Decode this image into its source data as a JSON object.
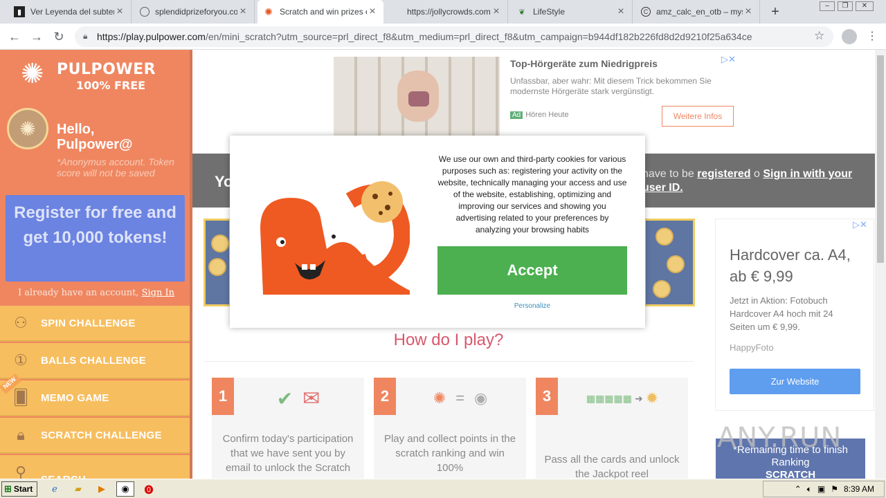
{
  "browser": {
    "tabs": [
      {
        "title": "Ver Leyenda del subterrá",
        "favicon": "film-icon"
      },
      {
        "title": "splendidprizeforyou.com",
        "favicon": "globe-icon"
      },
      {
        "title": "Scratch and win prizes e",
        "favicon": "octopus-icon",
        "active": true
      },
      {
        "title": "https://jollycrowds.com/",
        "favicon": "blank-icon"
      },
      {
        "title": "LifeStyle",
        "favicon": "leaf-icon"
      },
      {
        "title": "amz_calc_en_otb – mysi",
        "favicon": "c-icon"
      }
    ],
    "url_host": "https://play.pulpower.com",
    "url_path": "/en/mini_scratch?utm_source=prl_direct_f8&utm_medium=prl_direct_f8&utm_campaign=b944df182b226fd8d2d9210f25a634ce"
  },
  "sidebar": {
    "brand": "PULPOWER",
    "brand_sub": "100% FREE",
    "greeting": "Hello,",
    "username": "Pulpower@",
    "anon_note": "*Anonymus account. Token score will not be saved",
    "register_cta": "Register for free and get 10,000 tokens!",
    "already_text": "I already have an account,",
    "sign_in": "Sign In",
    "new_badge": "NEW",
    "menu": [
      {
        "label": "SPIN CHALLENGE",
        "icon": "bicycle-icon"
      },
      {
        "label": "BALLS CHALLENGE",
        "icon": "ball-icon"
      },
      {
        "label": "MEMO GAME",
        "icon": "cards-icon"
      },
      {
        "label": "SCRATCH CHALLENGE",
        "icon": "lock-icon"
      },
      {
        "label": "SEARCH",
        "icon": "search-icon"
      }
    ]
  },
  "top_ad": {
    "title": "Top-Hörgeräte zum Niedrigpreis",
    "text": "Unfassbar, aber wahr: Mit diesem Trick bekommen Sie modernste Hörgeräte stark vergünstigt.",
    "ad_label": "Ad",
    "advertiser": "Hören Heute",
    "button": "Weitere Infos"
  },
  "notice": {
    "prefix": "Yo",
    "text": "have to be",
    "registered": "registered",
    "or": "o",
    "sign_in_user": "Sign in with your user ID."
  },
  "howto": {
    "title": "How do I play?",
    "steps": [
      {
        "num": "1",
        "text": "Confirm today's participation that we have sent you by email to unlock the Scratch"
      },
      {
        "num": "2",
        "text": "Play and collect points in the scratch ranking and win 100%"
      },
      {
        "num": "3",
        "text": "Pass all the cards and unlock the Jackpot reel"
      }
    ]
  },
  "right_ad": {
    "headline": "Hardcover ca. A4, ab € 9,99",
    "text": "Jetzt in Aktion: Fotobuch Hardcover A4 hoch mit 24 Seiten um € 9,99.",
    "brand": "HappyFoto",
    "button": "Zur Website"
  },
  "right_banner": {
    "line1": "*Remaining time to finish",
    "line2": "Ranking",
    "line3": "SCRATCH"
  },
  "cookie": {
    "text": "We use our own and third-party cookies for various purposes such as: registering your activity on the website, technically managing your access and use of the website, establishing, optimizing and improving our services and showing you advertising related to your preferences by analyzing your browsing habits",
    "accept": "Accept",
    "personalize": "Personalize"
  },
  "watermark": "ANY.RUN",
  "taskbar": {
    "start": "Start",
    "clock": "8:39 AM"
  }
}
